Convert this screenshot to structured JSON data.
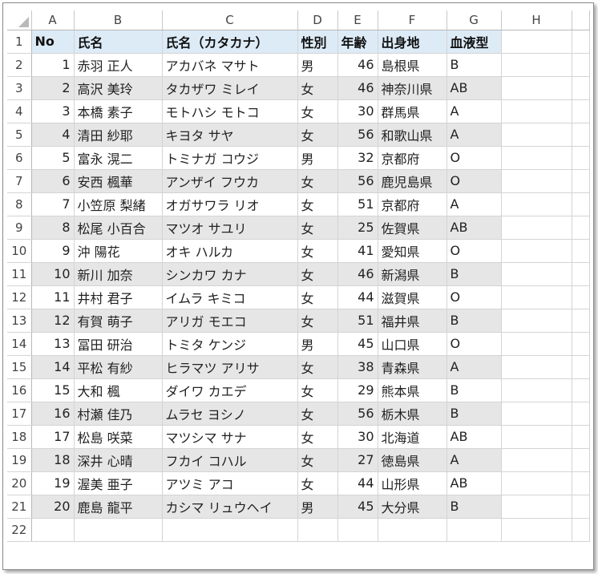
{
  "columns": [
    "A",
    "B",
    "C",
    "D",
    "E",
    "F",
    "G",
    "H"
  ],
  "header": {
    "row": "1",
    "no": "No",
    "name": "氏名",
    "kana": "氏名（カタカナ）",
    "gender": "性別",
    "age": "年齢",
    "birthplace": "出身地",
    "blood": "血液型"
  },
  "rows": [
    {
      "row": "2",
      "no": "1",
      "name": "赤羽 正人",
      "kana": "アカバネ マサト",
      "gender": "男",
      "age": "46",
      "birthplace": "島根県",
      "blood": "B"
    },
    {
      "row": "3",
      "no": "2",
      "name": "高沢 美玲",
      "kana": "タカザワ ミレイ",
      "gender": "女",
      "age": "46",
      "birthplace": "神奈川県",
      "blood": "AB"
    },
    {
      "row": "4",
      "no": "3",
      "name": "本橋 素子",
      "kana": "モトハシ モトコ",
      "gender": "女",
      "age": "30",
      "birthplace": "群馬県",
      "blood": "A"
    },
    {
      "row": "5",
      "no": "4",
      "name": "清田 紗耶",
      "kana": "キヨタ サヤ",
      "gender": "女",
      "age": "56",
      "birthplace": "和歌山県",
      "blood": "A"
    },
    {
      "row": "6",
      "no": "5",
      "name": "富永 滉二",
      "kana": "トミナガ コウジ",
      "gender": "男",
      "age": "32",
      "birthplace": "京都府",
      "blood": "O"
    },
    {
      "row": "7",
      "no": "6",
      "name": "安西 楓華",
      "kana": "アンザイ フウカ",
      "gender": "女",
      "age": "56",
      "birthplace": "鹿児島県",
      "blood": "O"
    },
    {
      "row": "8",
      "no": "7",
      "name": "小笠原 梨緒",
      "kana": "オガサワラ リオ",
      "gender": "女",
      "age": "51",
      "birthplace": "京都府",
      "blood": "A"
    },
    {
      "row": "9",
      "no": "8",
      "name": "松尾 小百合",
      "kana": "マツオ サユリ",
      "gender": "女",
      "age": "25",
      "birthplace": "佐賀県",
      "blood": "AB"
    },
    {
      "row": "10",
      "no": "9",
      "name": "沖 陽花",
      "kana": "オキ ハルカ",
      "gender": "女",
      "age": "41",
      "birthplace": "愛知県",
      "blood": "O"
    },
    {
      "row": "11",
      "no": "10",
      "name": "新川 加奈",
      "kana": "シンカワ カナ",
      "gender": "女",
      "age": "46",
      "birthplace": "新潟県",
      "blood": "B"
    },
    {
      "row": "12",
      "no": "11",
      "name": "井村 君子",
      "kana": "イムラ キミコ",
      "gender": "女",
      "age": "44",
      "birthplace": "滋賀県",
      "blood": "O"
    },
    {
      "row": "13",
      "no": "12",
      "name": "有賀 萌子",
      "kana": "アリガ モエコ",
      "gender": "女",
      "age": "51",
      "birthplace": "福井県",
      "blood": "B"
    },
    {
      "row": "14",
      "no": "13",
      "name": "冨田 研治",
      "kana": "トミタ ケンジ",
      "gender": "男",
      "age": "45",
      "birthplace": "山口県",
      "blood": "O"
    },
    {
      "row": "15",
      "no": "14",
      "name": "平松 有紗",
      "kana": "ヒラマツ アリサ",
      "gender": "女",
      "age": "38",
      "birthplace": "青森県",
      "blood": "A"
    },
    {
      "row": "16",
      "no": "15",
      "name": "大和 楓",
      "kana": "ダイワ カエデ",
      "gender": "女",
      "age": "29",
      "birthplace": "熊本県",
      "blood": "B"
    },
    {
      "row": "17",
      "no": "16",
      "name": "村瀬 佳乃",
      "kana": "ムラセ ヨシノ",
      "gender": "女",
      "age": "56",
      "birthplace": "栃木県",
      "blood": "B"
    },
    {
      "row": "18",
      "no": "17",
      "name": "松島 咲菜",
      "kana": "マツシマ サナ",
      "gender": "女",
      "age": "30",
      "birthplace": "北海道",
      "blood": "AB"
    },
    {
      "row": "19",
      "no": "18",
      "name": "深井 心晴",
      "kana": "フカイ コハル",
      "gender": "女",
      "age": "27",
      "birthplace": "徳島県",
      "blood": "A"
    },
    {
      "row": "20",
      "no": "19",
      "name": "渥美 亜子",
      "kana": "アツミ アコ",
      "gender": "女",
      "age": "44",
      "birthplace": "山形県",
      "blood": "AB"
    },
    {
      "row": "21",
      "no": "20",
      "name": "鹿島 龍平",
      "kana": "カシマ リュウヘイ",
      "gender": "男",
      "age": "45",
      "birthplace": "大分県",
      "blood": "B"
    }
  ],
  "empty_rows": [
    "22"
  ],
  "colors": {
    "header_fill": "#ddebf7",
    "band_fill": "#e7e6e6",
    "gridline": "#d4d4d4"
  }
}
